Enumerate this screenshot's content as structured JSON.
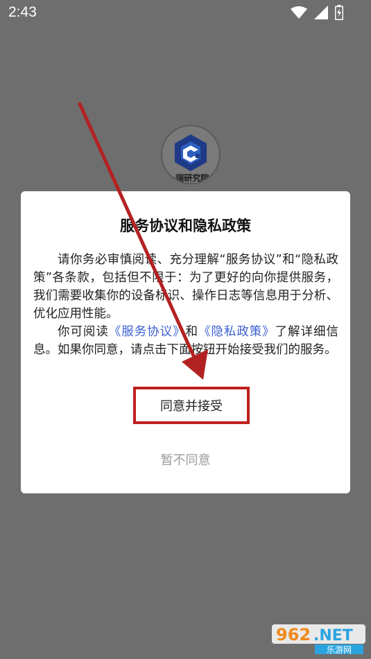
{
  "status_bar": {
    "time": "2:43",
    "icons": [
      "wifi-icon",
      "cellular-signal-icon",
      "battery-charging-icon"
    ]
  },
  "splash": {
    "logo_text": "·瑞研究院"
  },
  "dialog": {
    "title": "服务协议和隐私政策",
    "paragraph1": "请你务必审慎阅读、充分理解“服务协议”和“隐私政策”各条款，包括但不限于：为了更好的向你提供服务，我们需要收集你的设备标识、操作日志等信息用于分析、优化应用性能。",
    "paragraph2_prefix": "你可阅读",
    "link_service": "《服务协议》",
    "paragraph2_and": "和",
    "link_privacy": "《隐私政策》",
    "paragraph2_suffix": "了解详细信息。如果你同意，请点击下面按钮开始接受我们的服务。",
    "agree_label": "同意并接受",
    "decline_label": "暂不同意"
  },
  "colors": {
    "backdrop": "#6e6e6e",
    "link": "#3c5fd1",
    "annotation_red": "#c01f1f",
    "decline_text": "#9a9a9a"
  },
  "watermark": {
    "brand": "962",
    "suffix": ".NET",
    "subtitle": "乐游网"
  }
}
